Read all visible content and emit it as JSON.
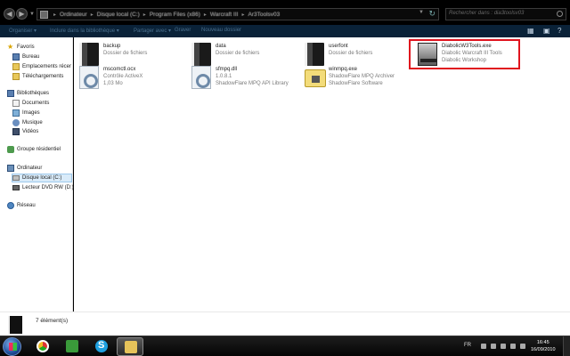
{
  "address": {
    "crumbs": [
      "Ordinateur",
      "Disque local (C:)",
      "Program Files (x86)",
      "Warcraft III",
      "Ar3Toolsv03"
    ]
  },
  "search": {
    "placeholder": "Rechercher dans : dia3toolsv03"
  },
  "toolbar": {
    "organize": "Organiser ▾",
    "include": "Inclure dans la bibliothèque ▾",
    "share": "Partager avec ▾",
    "burn": "Graver",
    "newfolder": "Nouveau dossier"
  },
  "sidebar": {
    "favorites": "Favoris",
    "fav_items": [
      "Bureau",
      "Emplacements récer",
      "Téléchargements"
    ],
    "libraries": "Bibliothèques",
    "lib_items": [
      "Documents",
      "Images",
      "Musique",
      "Vidéos"
    ],
    "homegroup": "Groupe résidentiel",
    "computer": "Ordinateur",
    "computer_items": [
      "Disque local (C:)",
      "Lecteur DVD RW (D:)"
    ],
    "network": "Réseau"
  },
  "files": [
    {
      "name": "backup",
      "d1": "Dossier de fichiers",
      "d2": "",
      "icon": "folder-dark-icon"
    },
    {
      "name": "data",
      "d1": "Dossier de fichiers",
      "d2": "",
      "icon": "folder-dark-icon"
    },
    {
      "name": "userfont",
      "d1": "Dossier de fichiers",
      "d2": "",
      "icon": "folder-dark-icon"
    },
    {
      "name": "DiabolicW3Tools.exe",
      "d1": "Diabolic Warcraft III Tools",
      "d2": "Diabolic Workshop",
      "icon": "app-icon"
    },
    {
      "name": "mscomctl.ocx",
      "d1": "Contrôle ActiveX",
      "d2": "1,03 Mo",
      "icon": "gear-file-icon"
    },
    {
      "name": "sfmpq.dll",
      "d1": "1.0.8.1",
      "d2": "ShadowFlare MPQ API Library",
      "icon": "gear-file-icon"
    },
    {
      "name": "winmpq.exe",
      "d1": "ShadowFlare MPQ Archiver",
      "d2": "ShadowFlare Software",
      "icon": "archive-icon"
    }
  ],
  "status": {
    "count": "7 élément(s)"
  },
  "taskbar": {
    "lang": "FR",
    "time": "16:45",
    "date": "16/09/2010"
  },
  "colors": {
    "highlight": "#e0141e",
    "selected_bg": "#d9ebf9",
    "toolbar_bg": "#0a2238"
  }
}
